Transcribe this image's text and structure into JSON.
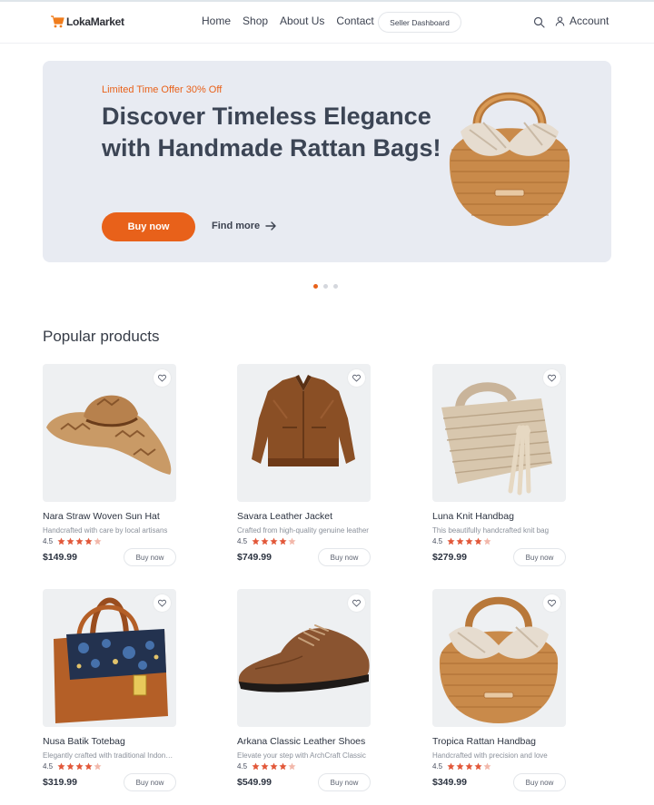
{
  "header": {
    "logo_text": "LokaMarket",
    "nav": [
      "Home",
      "Shop",
      "About Us",
      "Contact"
    ],
    "seller_button": "Seller Dashboard",
    "account_label": "Account"
  },
  "hero": {
    "offer": "Limited Time Offer 30% Off",
    "title": "Discover Timeless Elegance with Handmade Rattan Bags!",
    "buy_label": "Buy now",
    "more_label": "Find more"
  },
  "carousel": {
    "active_index": 0,
    "count": 3
  },
  "section": {
    "title": "Popular products"
  },
  "products": [
    {
      "name": "Nara Straw Woven Sun Hat",
      "desc": "Handcrafted with care by local artisans",
      "rating": "4.5",
      "price": "$149.99",
      "buy": "Buy now",
      "icon": "straw-hat"
    },
    {
      "name": "Savara Leather Jacket",
      "desc": "Crafted from high-quality genuine leather",
      "rating": "4.5",
      "price": "$749.99",
      "buy": "Buy now",
      "icon": "leather-jacket"
    },
    {
      "name": "Luna Knit Handbag",
      "desc": "This beautifully handcrafted knit bag",
      "rating": "4.5",
      "price": "$279.99",
      "buy": "Buy now",
      "icon": "knit-handbag"
    },
    {
      "name": "Nusa Batik Totebag",
      "desc": "Elegantly crafted with traditional Indonesian batik",
      "rating": "4.5",
      "price": "$319.99",
      "buy": "Buy now",
      "icon": "batik-totebag"
    },
    {
      "name": "Arkana Classic Leather Shoes",
      "desc": "Elevate your step with ArchCraft Classic",
      "rating": "4.5",
      "price": "$549.99",
      "buy": "Buy now",
      "icon": "leather-shoe"
    },
    {
      "name": "Tropica Rattan Handbag",
      "desc": "Handcrafted with precision and love",
      "rating": "4.5",
      "price": "$349.99",
      "buy": "Buy now",
      "icon": "rattan-handbag"
    }
  ],
  "colors": {
    "accent": "#e8611a",
    "star": "#e2583a",
    "star_empty": "#f2b8ab",
    "hero_bg": "#e8ebf2",
    "card_bg": "#eef0f2"
  }
}
